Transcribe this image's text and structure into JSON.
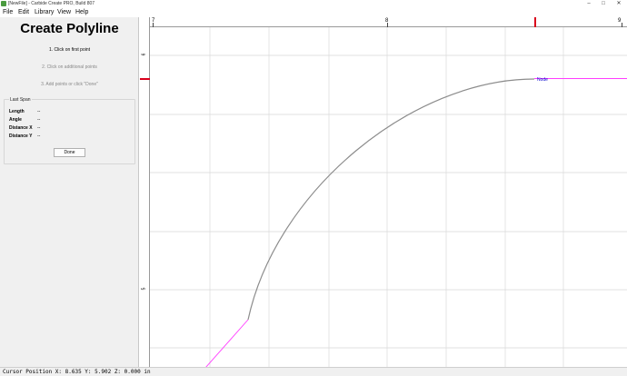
{
  "window": {
    "title": "[NewFile] - Carbide Create PRO, Build 807",
    "icon": "carbide-create-icon",
    "controls": {
      "minimize": "–",
      "maximize": "□",
      "close": "✕"
    }
  },
  "menu": [
    {
      "label": "File"
    },
    {
      "label": "Edit"
    },
    {
      "label": "Library"
    },
    {
      "label": "View"
    },
    {
      "label": "Help"
    }
  ],
  "panel": {
    "title": "Create Polyline",
    "steps": [
      {
        "label": "1. Click on first point",
        "active": true
      },
      {
        "label": "2. Click on additional points",
        "active": false
      },
      {
        "label": "3. Add points or click \"Done\"",
        "active": false
      }
    ],
    "last_span": {
      "legend": "Last Span",
      "rows": [
        {
          "label": "Length",
          "value": "--"
        },
        {
          "label": "Angle",
          "value": "--"
        },
        {
          "label": "Distance X",
          "value": "--"
        },
        {
          "label": "Distance Y",
          "value": "--"
        }
      ]
    },
    "done_label": "Done"
  },
  "canvas": {
    "ruler_x_labels": [
      "7",
      "8",
      "9"
    ],
    "ruler_y_labels": [
      "6",
      "5"
    ],
    "node_label": "Node",
    "colors": {
      "grid": "#d9d9d9",
      "curve": "#8c8c8c",
      "preview": "#ff3dff",
      "node": "#0000cc",
      "cursor_marker": "#d9001b"
    }
  },
  "status": {
    "text": "Cursor Position X: 8.635 Y: 5.902 Z: 0.000 in"
  }
}
